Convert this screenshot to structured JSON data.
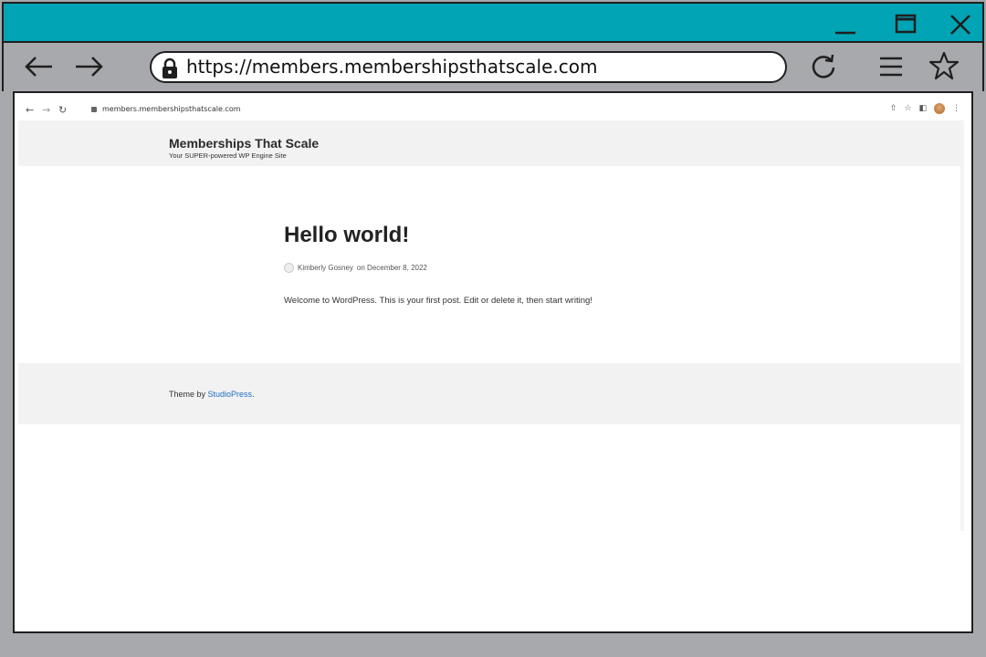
{
  "browser": {
    "url": "https://members.membershipsthatscale.com",
    "window_controls": {
      "minimize": "minimize-icon",
      "maximize": "maximize-icon",
      "close": "close-icon"
    },
    "nav_icons": [
      "back-arrow-icon",
      "forward-arrow-icon",
      "reload-icon",
      "menu-icon",
      "star-icon"
    ],
    "colors": {
      "titlebar": "#00a4b4",
      "chrome": "#a8a9ad"
    }
  },
  "inner_browser": {
    "url": "members.membershipsthatscale.com"
  },
  "site": {
    "title": "Memberships That Scale",
    "tagline": "Your SUPER-powered WP Engine Site"
  },
  "post": {
    "title": "Hello world!",
    "author": "Kimberly Gosney",
    "date_text": "on December 8, 2022",
    "body": "Welcome to WordPress. This is your first post. Edit or delete it, then start writing!"
  },
  "footer": {
    "prefix": "Theme by ",
    "link_text": "StudioPress",
    "suffix": "."
  }
}
